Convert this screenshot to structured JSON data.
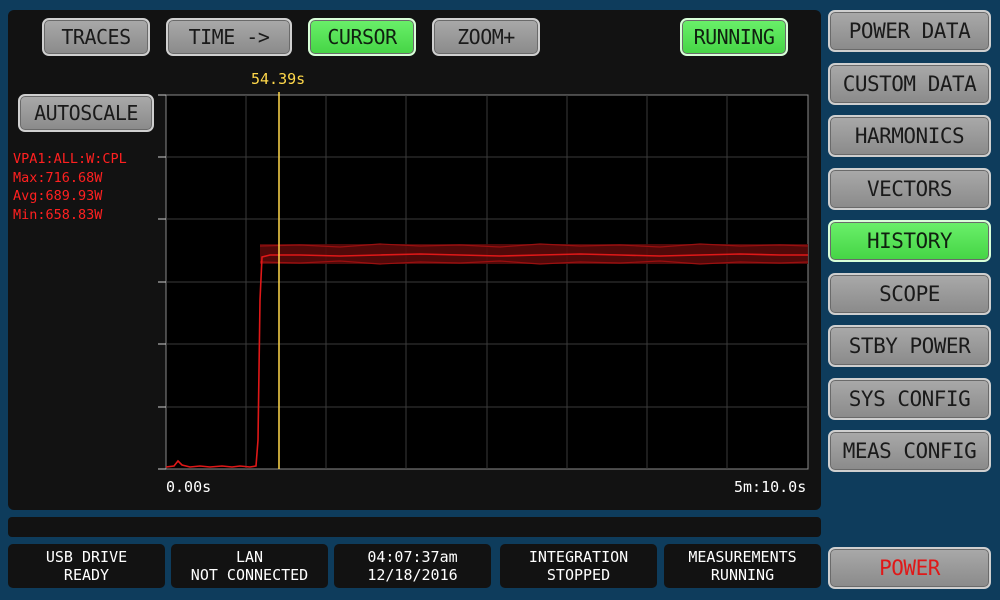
{
  "toolbar": {
    "traces": "TRACES",
    "time": "TIME ->",
    "cursor": "CURSOR",
    "zoom": "ZOOM+",
    "running": "RUNNING"
  },
  "autoscale": "AUTOSCALE",
  "cursor": {
    "time_label": "54.39s"
  },
  "trace_stats": {
    "name": "VPA1:ALL:W:CPL",
    "max": "Max:716.68W",
    "avg": "Avg:689.93W",
    "min": "Min:658.83W"
  },
  "axis": {
    "x_start": "0.00s",
    "x_end": "5m:10.0s"
  },
  "sidebar": {
    "items": [
      {
        "label": "POWER DATA",
        "active": false
      },
      {
        "label": "CUSTOM DATA",
        "active": false
      },
      {
        "label": "HARMONICS",
        "active": false
      },
      {
        "label": "VECTORS",
        "active": false
      },
      {
        "label": "HISTORY",
        "active": true
      },
      {
        "label": "SCOPE",
        "active": false
      },
      {
        "label": "STBY POWER",
        "active": false
      },
      {
        "label": "SYS CONFIG",
        "active": false
      },
      {
        "label": "MEAS CONFIG",
        "active": false
      }
    ],
    "power": "POWER"
  },
  "status_bar": [
    {
      "line1": "USB DRIVE",
      "line2": "READY"
    },
    {
      "line1": "LAN",
      "line2": "NOT CONNECTED"
    },
    {
      "line1": "04:07:37am",
      "line2": "12/18/2016"
    },
    {
      "line1": "INTEGRATION",
      "line2": "STOPPED"
    },
    {
      "line1": "MEASUREMENTS",
      "line2": "RUNNING"
    }
  ],
  "colors": {
    "background": "#0e3c5c",
    "panel": "#121212",
    "button_gray": "#9a9a9a",
    "button_active": "#5ae55a",
    "trace": "#cc1010",
    "cursor_line": "#ffd84a",
    "power_text": "#e01818"
  }
}
